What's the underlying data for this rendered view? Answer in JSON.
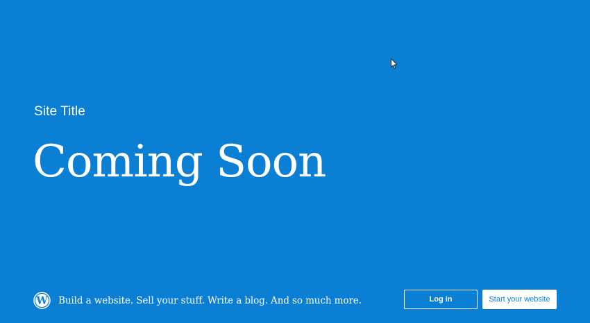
{
  "colors": {
    "background": "#0a7fd3",
    "text": "#ffffff",
    "button_primary_text": "#0a7fd3"
  },
  "hero": {
    "site_title": "Site Title",
    "headline": "Coming Soon"
  },
  "footer": {
    "logo_icon": "wordpress-logo-icon",
    "tagline": "Build a website. Sell your stuff. Write a blog. And so much more.",
    "login_label": "Log in",
    "start_label": "Start your website"
  },
  "cursor_icon": "mouse-pointer-icon"
}
